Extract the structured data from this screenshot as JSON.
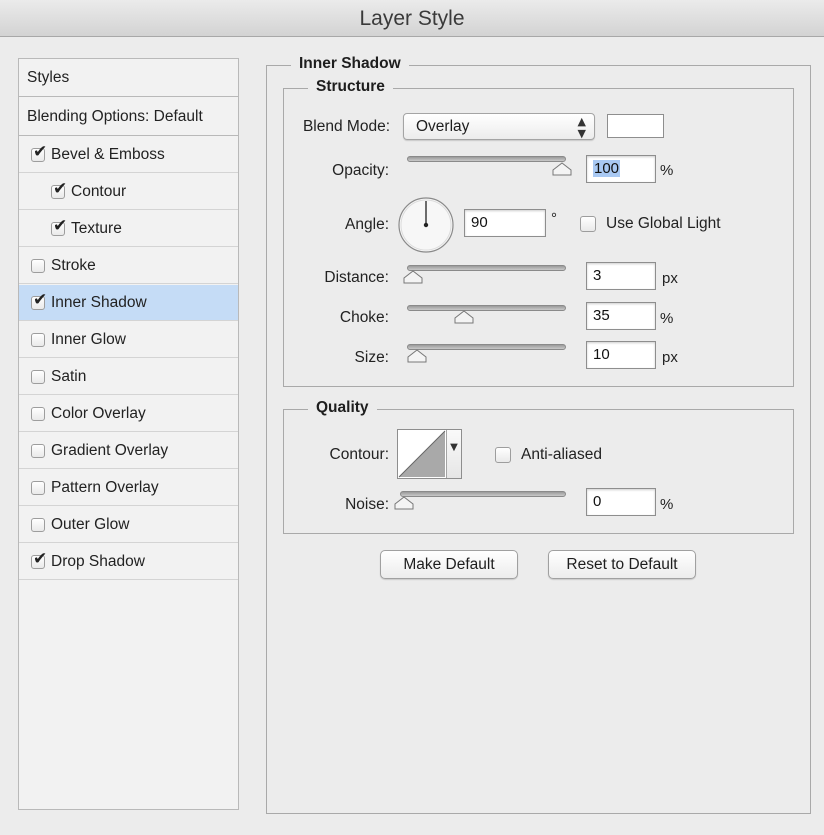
{
  "window": {
    "title": "Layer Style"
  },
  "sidebar": {
    "items": [
      {
        "label": "Styles",
        "checkbox": false
      },
      {
        "label": "Blending Options: Default",
        "checkbox": false
      },
      {
        "label": "Bevel & Emboss",
        "checkbox": true,
        "checked": true
      },
      {
        "label": "Contour",
        "checkbox": true,
        "checked": true,
        "indent": true
      },
      {
        "label": "Texture",
        "checkbox": true,
        "checked": true,
        "indent": true
      },
      {
        "label": "Stroke",
        "checkbox": true,
        "checked": false
      },
      {
        "label": "Inner Shadow",
        "checkbox": true,
        "checked": true,
        "selected": true
      },
      {
        "label": "Inner Glow",
        "checkbox": true,
        "checked": false
      },
      {
        "label": "Satin",
        "checkbox": true,
        "checked": false
      },
      {
        "label": "Color Overlay",
        "checkbox": true,
        "checked": false
      },
      {
        "label": "Gradient Overlay",
        "checkbox": true,
        "checked": false
      },
      {
        "label": "Pattern Overlay",
        "checkbox": true,
        "checked": false
      },
      {
        "label": "Outer Glow",
        "checkbox": true,
        "checked": false
      },
      {
        "label": "Drop Shadow",
        "checkbox": true,
        "checked": true
      }
    ]
  },
  "panel": {
    "title": "Inner Shadow",
    "structure": {
      "title": "Structure",
      "blend_mode_label": "Blend Mode:",
      "blend_mode_value": "Overlay",
      "blend_color": "#ffffff",
      "opacity_label": "Opacity:",
      "opacity_value": "100",
      "opacity_unit": "%",
      "angle_label": "Angle:",
      "angle_value": "90",
      "angle_unit": "°",
      "use_global_light_label": "Use Global Light",
      "use_global_light_checked": false,
      "distance_label": "Distance:",
      "distance_value": "3",
      "distance_unit": "px",
      "choke_label": "Choke:",
      "choke_value": "35",
      "choke_unit": "%",
      "size_label": "Size:",
      "size_value": "10",
      "size_unit": "px"
    },
    "quality": {
      "title": "Quality",
      "contour_label": "Contour:",
      "anti_aliased_label": "Anti-aliased",
      "anti_aliased_checked": false,
      "noise_label": "Noise:",
      "noise_value": "0",
      "noise_unit": "%"
    },
    "buttons": {
      "make_default": "Make Default",
      "reset_default": "Reset to Default"
    }
  },
  "sliders": {
    "opacity": 1.0,
    "distance": 0.012,
    "choke": 0.35,
    "size": 0.04,
    "noise": 0.0
  }
}
